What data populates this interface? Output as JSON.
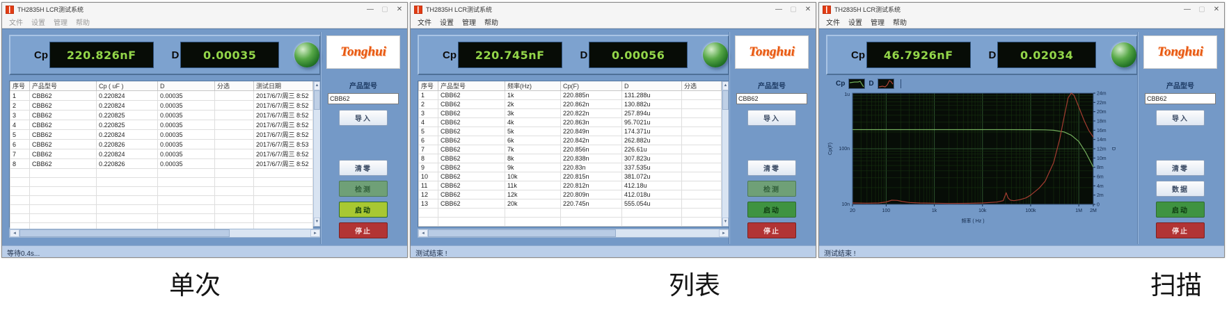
{
  "app": {
    "title": "TH2835H LCR测试系统",
    "menu": [
      "文件",
      "设置",
      "管理",
      "帮助"
    ],
    "window_controls": {
      "minimize": "—",
      "maximize": "▢",
      "close": "✕"
    },
    "brand": "Tonghui",
    "icons": {
      "up": "▲",
      "down": "▼",
      "left": "◄",
      "right": "►"
    },
    "colors": {
      "body_blue": "#7499c7",
      "lcd_text": "#93d649",
      "indicator_green": "#2e8b2e",
      "start_green": "#3f9341",
      "start_yellow_green": "#a8c832",
      "stop_red": "#b23434",
      "logo_orange": "#e8570f"
    }
  },
  "captions": [
    "单次",
    "列表",
    "扫描"
  ],
  "windows": [
    {
      "display": {
        "cp_label": "Cp",
        "cp_value": "220.826nF",
        "d_label": "D",
        "d_value": "0.00035"
      },
      "sidebar": {
        "product_label": "产品型号",
        "product_value": "CBB62",
        "import_label": "导入",
        "zero_label": "清零",
        "aux_label": "检测",
        "aux_variant": "muted",
        "start_label": "启动",
        "start_color": "#a8c832",
        "stop_label": "停止"
      },
      "status": "等待0.4s...",
      "table": {
        "headers": [
          "序号",
          "产品型号",
          "Cp ( uF )",
          "D",
          "分选",
          "测试日期"
        ],
        "rows": [
          [
            "1",
            "CBB62",
            "0.220824",
            "0.00035",
            "",
            "2017/6/7/周三 8:52"
          ],
          [
            "2",
            "CBB62",
            "0.220824",
            "0.00035",
            "",
            "2017/6/7/周三 8:52"
          ],
          [
            "3",
            "CBB62",
            "0.220825",
            "0.00035",
            "",
            "2017/6/7/周三 8:52"
          ],
          [
            "4",
            "CBB62",
            "0.220825",
            "0.00035",
            "",
            "2017/6/7/周三 8:52"
          ],
          [
            "5",
            "CBB62",
            "0.220824",
            "0.00035",
            "",
            "2017/6/7/周三 8:52"
          ],
          [
            "6",
            "CBB62",
            "0.220826",
            "0.00035",
            "",
            "2017/6/7/周三 8:53"
          ],
          [
            "7",
            "CBB62",
            "0.220824",
            "0.00035",
            "",
            "2017/6/7/周三 8:52"
          ],
          [
            "8",
            "CBB62",
            "0.220826",
            "0.00035",
            "",
            "2017/6/7/周三 8:52"
          ]
        ],
        "empty_rows": 7
      }
    },
    {
      "display": {
        "cp_label": "Cp",
        "cp_value": "220.745nF",
        "d_label": "D",
        "d_value": "0.00056"
      },
      "sidebar": {
        "product_label": "产品型号",
        "product_value": "CBB62",
        "import_label": "导入",
        "zero_label": "清零",
        "aux_label": "检测",
        "aux_variant": "muted",
        "start_label": "启动",
        "start_color": "#3f9341",
        "stop_label": "停止"
      },
      "status": "测试结束 !",
      "table": {
        "headers": [
          "序号",
          "产品型号",
          "频率(Hz)",
          "Cp(F)",
          "D",
          "分选"
        ],
        "rows": [
          [
            "1",
            "CBB62",
            "1k",
            "220.885n",
            "131.288u",
            ""
          ],
          [
            "2",
            "CBB62",
            "2k",
            "220.862n",
            "130.882u",
            ""
          ],
          [
            "3",
            "CBB62",
            "3k",
            "220.822n",
            "257.894u",
            ""
          ],
          [
            "4",
            "CBB62",
            "4k",
            "220.863n",
            "95.7021u",
            ""
          ],
          [
            "5",
            "CBB62",
            "5k",
            "220.849n",
            "174.371u",
            ""
          ],
          [
            "6",
            "CBB62",
            "6k",
            "220.842n",
            "262.882u",
            ""
          ],
          [
            "7",
            "CBB62",
            "7k",
            "220.856n",
            "226.61u",
            ""
          ],
          [
            "8",
            "CBB62",
            "8k",
            "220.838n",
            "307.823u",
            ""
          ],
          [
            "9",
            "CBB62",
            "9k",
            "220.83n",
            "337.535u",
            ""
          ],
          [
            "10",
            "CBB62",
            "10k",
            "220.815n",
            "381.072u",
            ""
          ],
          [
            "11",
            "CBB62",
            "11k",
            "220.812n",
            "412.18u",
            ""
          ],
          [
            "12",
            "CBB62",
            "12k",
            "220.809n",
            "412.018u",
            ""
          ],
          [
            "13",
            "CBB62",
            "20k",
            "220.745n",
            "555.054u",
            ""
          ]
        ],
        "empty_rows": 2
      }
    },
    {
      "display": {
        "cp_label": "Cp",
        "cp_value": "46.7926nF",
        "d_label": "D",
        "d_value": "0.02034"
      },
      "sidebar": {
        "product_label": "产品型号",
        "product_value": "CBB62",
        "import_label": "导入",
        "zero_label": "清零",
        "aux_label": "数据",
        "aux_variant": "normal",
        "start_label": "启动",
        "start_color": "#3f9341",
        "stop_label": "停止"
      },
      "status": "测试结束 !",
      "tabs": [
        {
          "label": "Cp"
        },
        {
          "label": "D"
        }
      ]
    }
  ],
  "chart_data": {
    "type": "line",
    "title": "",
    "xlabel": "频率 ( Hz )",
    "ylabel_left": "Cp(F)",
    "ylabel_right": "D",
    "x_scale": "log",
    "x_range": [
      20,
      2000000
    ],
    "x_ticks": [
      "20",
      "100",
      "1k",
      "10k",
      "100k",
      "1M",
      "2M"
    ],
    "y_left_scale": "log",
    "y_left_range": [
      1e-08,
      1e-06
    ],
    "y_left_ticks": [
      "1u",
      "100n",
      "10n"
    ],
    "y_right_scale": "linear",
    "y_right_range": [
      0,
      0.024
    ],
    "y_right_tick_step": 0.002,
    "grid": true,
    "plot_bg": "#070d07",
    "series": [
      {
        "name": "Cp",
        "color": "#76b05e",
        "axis": "left",
        "x": [
          20,
          50,
          100,
          300,
          1000,
          3000,
          10000,
          30000,
          100000,
          200000,
          300000,
          500000,
          700000,
          1000000,
          1400000,
          2000000
        ],
        "y": [
          2.209e-07,
          2.209e-07,
          2.2088e-07,
          2.2087e-07,
          2.2086e-07,
          2.2085e-07,
          2.2082e-07,
          2.208e-07,
          2.2e-07,
          2.19e-07,
          2.15e-07,
          2e-07,
          1.75e-07,
          1.35e-07,
          8.5e-08,
          4.68e-08
        ]
      },
      {
        "name": "D",
        "color": "#a33c30",
        "axis": "right",
        "x": [
          20,
          40,
          70,
          100,
          130,
          170,
          220,
          300,
          500,
          1000,
          2000,
          5000,
          10000,
          20000,
          27000,
          31000,
          34000,
          38000,
          45000,
          60000,
          80000,
          100000,
          150000,
          200000,
          300000,
          400000,
          500000,
          600000,
          700000,
          800000,
          1000000,
          1300000,
          1600000,
          2000000
        ],
        "y": [
          0.0003,
          0.00025,
          0.0003,
          0.0005,
          0.0009,
          0.00085,
          0.0006,
          0.0004,
          0.0003,
          0.00025,
          0.0002,
          0.00022,
          0.0003,
          0.0005,
          0.0008,
          0.0025,
          0.0014,
          0.0009,
          0.0008,
          0.001,
          0.0014,
          0.002,
          0.0035,
          0.005,
          0.009,
          0.014,
          0.019,
          0.023,
          0.024,
          0.0235,
          0.021,
          0.018,
          0.016,
          0.0145
        ]
      }
    ]
  }
}
